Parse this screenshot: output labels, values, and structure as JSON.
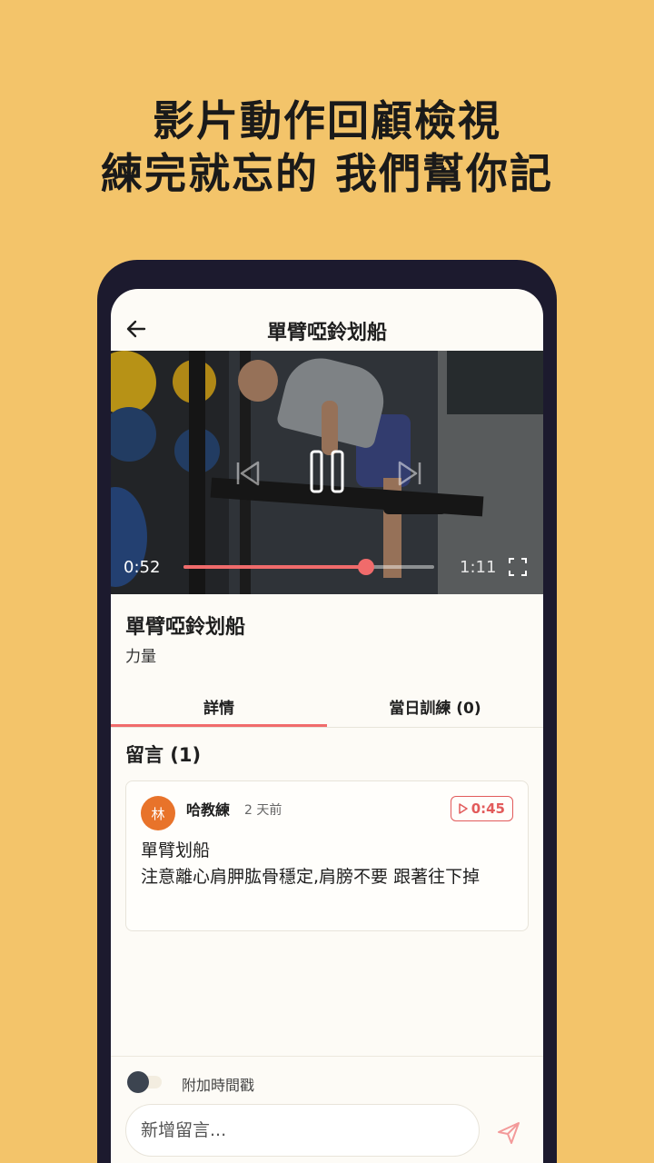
{
  "promo": {
    "line1": "影片動作回顧檢視",
    "line2": "練完就忘的 我們幫你記"
  },
  "appbar": {
    "title": "單臂啞鈴划船"
  },
  "video": {
    "current_time": "0:52",
    "total_time": "1:11",
    "progress": 0.73
  },
  "exercise": {
    "name": "單臂啞鈴划船",
    "category": "力量"
  },
  "tabs": [
    {
      "label": "詳情",
      "active": true
    },
    {
      "label": "當日訓練 (0)",
      "active": false
    }
  ],
  "comments": {
    "title": "留言 (1)",
    "items": [
      {
        "avatar_text": "林",
        "author": "哈教練",
        "ago": "2 天前",
        "timestamp": "0:45",
        "line1": "單臂划船",
        "line2": "注意離心肩胛肱骨穩定,肩膀不要 跟著往下掉"
      }
    ]
  },
  "composer": {
    "toggle_label": "附加時間戳",
    "placeholder": "新增留言..."
  },
  "colors": {
    "background": "#F3C46A",
    "accent": "#f06b6b",
    "avatar": "#e8732a"
  }
}
